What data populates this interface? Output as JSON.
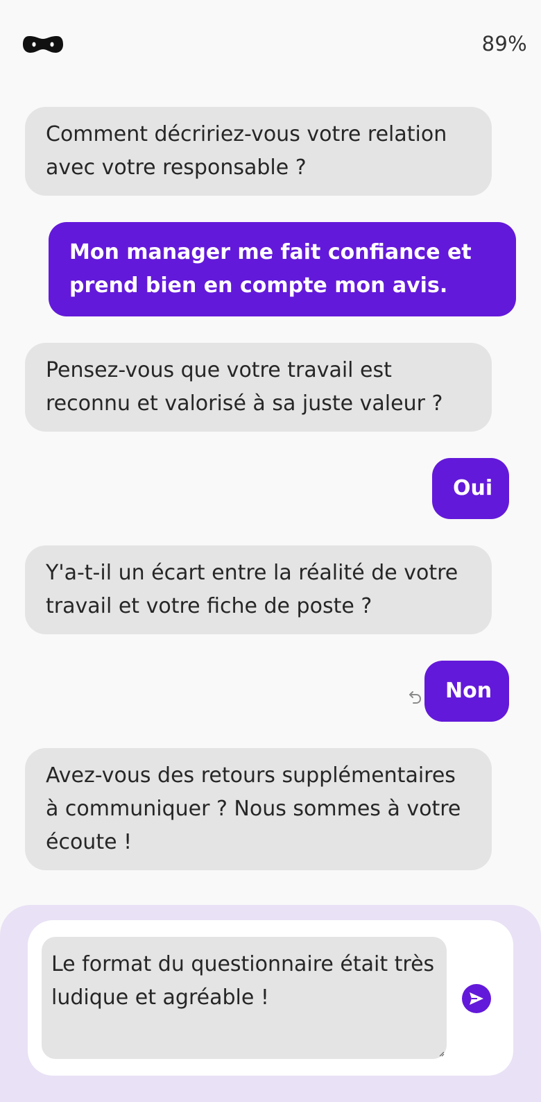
{
  "header": {
    "logo_icon": "mask-icon",
    "progress": "89%"
  },
  "conversation": {
    "messages": [
      {
        "from": "bot",
        "text": " Comment décririez-vous votre relation avec votre responsable ?"
      },
      {
        "from": "user",
        "text": "Mon manager me fait confiance et prend bien en compte mon avis."
      },
      {
        "from": "bot",
        "text": " Pensez-vous que votre travail est reconnu et valorisé à sa juste valeur ?"
      },
      {
        "from": "user",
        "text": "Oui"
      },
      {
        "from": "bot",
        "text": " Y'a-t-il un écart entre la réalité de votre travail et votre fiche de poste ?"
      },
      {
        "from": "user",
        "text": "Non"
      },
      {
        "from": "bot",
        "text": " Avez-vous des retours supplémentaires à communiquer ? Nous sommes à votre écoute !"
      }
    ],
    "undo_icon": "undo-arrow-icon"
  },
  "composer": {
    "value": "Le format du questionnaire était très ludique et agréable !",
    "send_icon": "send-icon"
  },
  "colors": {
    "accent": "#6319d9",
    "bot_bubble": "#e4e4e4",
    "background": "#f9f9f9",
    "composer_background": "#e9e1f5"
  }
}
